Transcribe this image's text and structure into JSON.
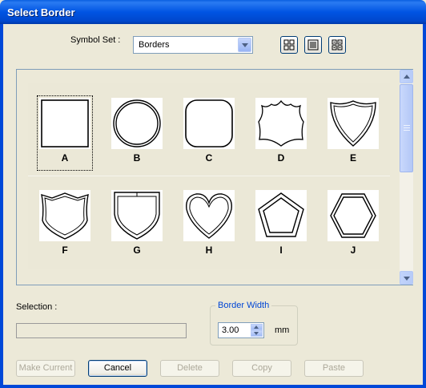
{
  "window": {
    "title": "Select Border"
  },
  "symbol_set": {
    "label": "Symbol Set :",
    "value": "Borders"
  },
  "view_buttons": [
    {
      "icon": "large-icons-view-icon"
    },
    {
      "icon": "list-view-icon"
    },
    {
      "icon": "small-icons-view-icon"
    }
  ],
  "symbols": [
    {
      "label": "A",
      "shape": "square",
      "selected": true
    },
    {
      "label": "B",
      "shape": "circle",
      "selected": false
    },
    {
      "label": "C",
      "shape": "rounded-square",
      "selected": false
    },
    {
      "label": "D",
      "shape": "badge",
      "selected": false
    },
    {
      "label": "E",
      "shape": "shield",
      "selected": false
    },
    {
      "label": "F",
      "shape": "crest",
      "selected": false
    },
    {
      "label": "G",
      "shape": "shield-flat",
      "selected": false
    },
    {
      "label": "H",
      "shape": "heart",
      "selected": false
    },
    {
      "label": "I",
      "shape": "pentagon",
      "selected": false
    },
    {
      "label": "J",
      "shape": "hexagon",
      "selected": false
    }
  ],
  "selection": {
    "label": "Selection :",
    "value": ""
  },
  "border_width": {
    "legend": "Border Width",
    "value": "3.00",
    "unit": "mm"
  },
  "buttons": {
    "make_current": "Make Current",
    "cancel": "Cancel",
    "delete": "Delete",
    "copy": "Copy",
    "paste": "Paste"
  }
}
